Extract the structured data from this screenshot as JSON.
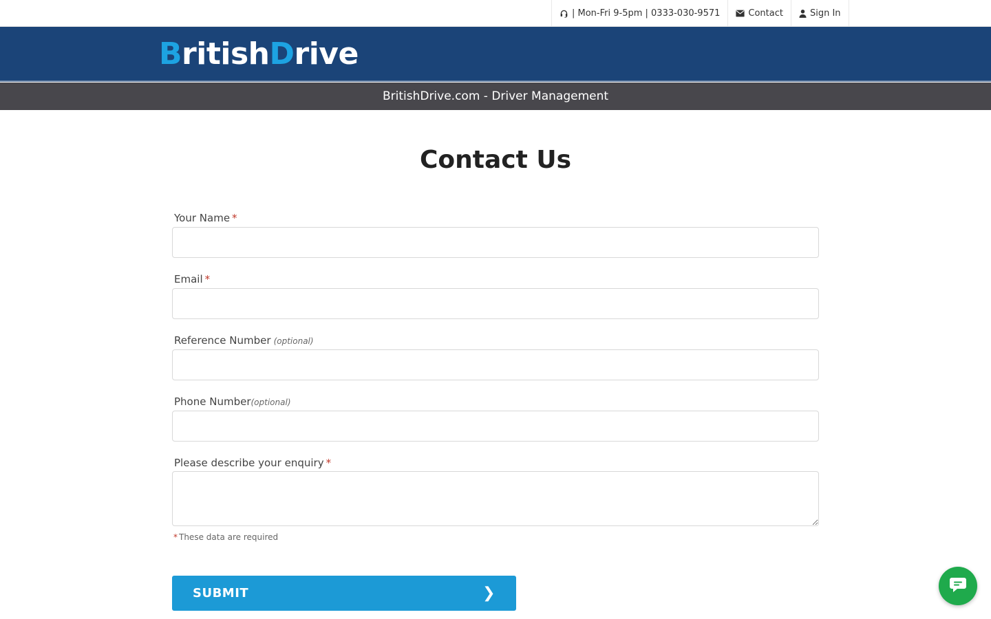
{
  "topbar": {
    "hours_phone": "| Mon-Fri 9-5pm | 0333-030-9571",
    "contact_label": "Contact",
    "signin_label": "Sign In"
  },
  "brand": {
    "logo_part1_initial": "B",
    "logo_part1_rest": "ritish",
    "logo_part2_initial": "D",
    "logo_part2_rest": "rive",
    "accent_color": "#1da3e2",
    "header_color": "#1b4478"
  },
  "subbar": {
    "title": "BritishDrive.com - Driver Management"
  },
  "form": {
    "title": "Contact Us",
    "fields": [
      {
        "label": "Your Name",
        "required_mark": "*",
        "value": ""
      },
      {
        "label": "Email",
        "required_mark": "*",
        "value": ""
      },
      {
        "label": "Reference Number",
        "optional_text": "(optional)",
        "value": ""
      },
      {
        "label": "Phone Number",
        "optional_text": "(optional)",
        "value": ""
      },
      {
        "label": "Please describe your enquiry",
        "required_mark": "*",
        "value": ""
      }
    ],
    "required_note_star": "*",
    "required_note": "These data are required",
    "submit_label": "SUBMIT",
    "submit_color": "#1c9ad6"
  },
  "chat": {
    "icon": "chat-bubble-icon",
    "color": "#1faa4c"
  }
}
